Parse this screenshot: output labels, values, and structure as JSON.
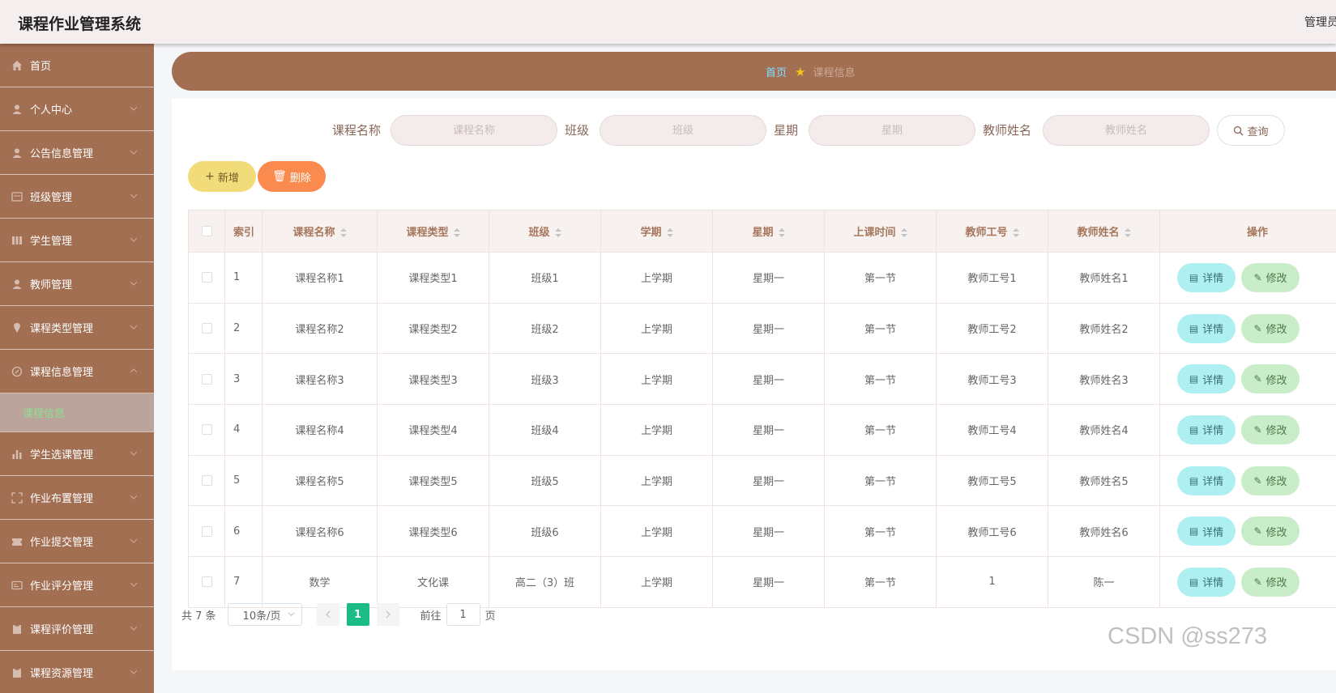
{
  "app": {
    "title": "课程作业管理系统",
    "user_label": "管理员"
  },
  "sidebar": {
    "items": [
      {
        "label": "首页",
        "icon": "home-icon"
      },
      {
        "label": "个人中心",
        "icon": "user-icon"
      },
      {
        "label": "公告信息管理",
        "icon": "user-icon"
      },
      {
        "label": "班级管理",
        "icon": "message-icon"
      },
      {
        "label": "学生管理",
        "icon": "grid-icon"
      },
      {
        "label": "教师管理",
        "icon": "user-icon"
      },
      {
        "label": "课程类型管理",
        "icon": "location-icon"
      },
      {
        "label": "课程信息管理",
        "icon": "compass-icon"
      },
      {
        "label": "学生选课管理",
        "icon": "chart-icon"
      },
      {
        "label": "作业布置管理",
        "icon": "fullscreen-icon"
      },
      {
        "label": "作业提交管理",
        "icon": "ticket-icon"
      },
      {
        "label": "作业评分管理",
        "icon": "card-icon"
      },
      {
        "label": "课程评价管理",
        "icon": "clipboard-icon"
      },
      {
        "label": "课程资源管理",
        "icon": "clipboard-icon"
      }
    ],
    "active_sub": "课程信息"
  },
  "breadcrumb": {
    "home": "首页",
    "current": "课程信息"
  },
  "search": {
    "course_name_label": "课程名称",
    "course_name_placeholder": "课程名称",
    "class_label": "班级",
    "class_placeholder": "班级",
    "week_label": "星期",
    "week_placeholder": "星期",
    "teacher_label": "教师姓名",
    "teacher_placeholder": "教师姓名",
    "query_label": "查询"
  },
  "actions": {
    "add_label": "新增",
    "delete_label": "删除"
  },
  "table": {
    "headers": {
      "index": "索引",
      "course_name": "课程名称",
      "course_type": "课程类型",
      "class": "班级",
      "term": "学期",
      "week": "星期",
      "time": "上课时间",
      "teacher_no": "教师工号",
      "teacher_name": "教师姓名",
      "ops": "操作"
    },
    "detail_label": "详情",
    "edit_label": "修改",
    "rows": [
      {
        "index": "1",
        "course_name": "课程名称1",
        "course_type": "课程类型1",
        "class": "班级1",
        "term": "上学期",
        "week": "星期一",
        "time": "第一节",
        "teacher_no": "教师工号1",
        "teacher_name": "教师姓名1"
      },
      {
        "index": "2",
        "course_name": "课程名称2",
        "course_type": "课程类型2",
        "class": "班级2",
        "term": "上学期",
        "week": "星期一",
        "time": "第一节",
        "teacher_no": "教师工号2",
        "teacher_name": "教师姓名2"
      },
      {
        "index": "3",
        "course_name": "课程名称3",
        "course_type": "课程类型3",
        "class": "班级3",
        "term": "上学期",
        "week": "星期一",
        "time": "第一节",
        "teacher_no": "教师工号3",
        "teacher_name": "教师姓名3"
      },
      {
        "index": "4",
        "course_name": "课程名称4",
        "course_type": "课程类型4",
        "class": "班级4",
        "term": "上学期",
        "week": "星期一",
        "time": "第一节",
        "teacher_no": "教师工号4",
        "teacher_name": "教师姓名4"
      },
      {
        "index": "5",
        "course_name": "课程名称5",
        "course_type": "课程类型5",
        "class": "班级5",
        "term": "上学期",
        "week": "星期一",
        "time": "第一节",
        "teacher_no": "教师工号5",
        "teacher_name": "教师姓名5"
      },
      {
        "index": "6",
        "course_name": "课程名称6",
        "course_type": "课程类型6",
        "class": "班级6",
        "term": "上学期",
        "week": "星期一",
        "time": "第一节",
        "teacher_no": "教师工号6",
        "teacher_name": "教师姓名6"
      },
      {
        "index": "7",
        "course_name": "数学",
        "course_type": "文化课",
        "class": "高二（3）班",
        "term": "上学期",
        "week": "星期一",
        "time": "第一节",
        "teacher_no": "1",
        "teacher_name": "陈一"
      }
    ]
  },
  "pagination": {
    "total_text": "共 7 条",
    "page_size": "10条/页",
    "current_page": "1",
    "goto_prefix": "前往",
    "goto_value": "1",
    "goto_suffix": "页"
  },
  "watermark": "CSDN @ss273",
  "colors": {
    "sidebar": "#a26f53",
    "topbar": "#f4eeee",
    "active_page": "#1bbc86",
    "add_button": "#f2dc7a",
    "delete_button": "#fb8a4e",
    "detail_button": "#aef0f2",
    "edit_button": "#c9ecc9"
  }
}
